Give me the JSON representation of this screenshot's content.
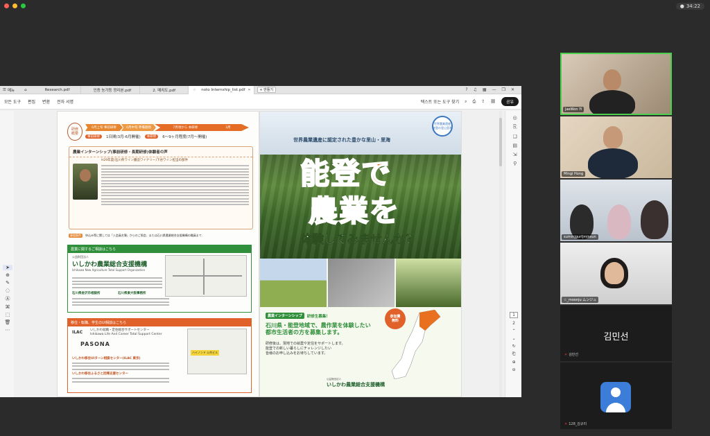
{
  "window": {
    "clock": "34:22"
  },
  "pdf": {
    "tabs": [
      {
        "label": "메뉴"
      },
      {
        "label": "Research.pdf"
      },
      {
        "label": "인증 농가등 정리본.pdf"
      },
      {
        "label": "2. 매치도.pdf"
      },
      {
        "label": "noto Internship_list.pdf",
        "active": true
      }
    ],
    "new_tab_label": "+ 만들기",
    "menu": [
      "모든 도구",
      "편집",
      "변환",
      "전자 서명"
    ],
    "search_placeholder": "텍스트 또는 도구 찾기",
    "share_label": "공유",
    "page_numbers": [
      "1",
      "2"
    ]
  },
  "doc_left": {
    "schedule_badge": "研修\n概要",
    "steps": [
      "6月上旬  事前研修",
      "6月中旬  準備期間",
      "7月頃から   本研修"
    ],
    "step_end": "3月",
    "line2_tag1": "事前研修",
    "line2_text1": "1日間(3月-6月開催)",
    "line2_tag2": "本研修",
    "line2_text2": "6〜9ヶ月程度(7月〜開催)",
    "interview_title": "農業インターンシップ(事前研修・長期研修)体験者の声",
    "interview_name": "H29年度(石川県ワイン醸造ワイナリー)下谷ワイン担当の部件",
    "note_tag": "参加条件",
    "note_text": "申込み等に関しては「入会員名簿」からのご照会、または石川県農業総合支援機構の職員まで.",
    "box1_title": "農業に関するご相談はこちら",
    "org_name": "いしかわ農業総合支援機構",
    "org_prefix": "公益財団法人",
    "org_en": "Ishikawa New Agriculture Total Support Organization",
    "branch1": "石川県金沢市相談所",
    "branch2": "石川県東大阪事務所",
    "box2_title": "移住・転職、学生のUI相談はこちら",
    "ilac_logo": "ILAC",
    "ilac_text": "いしかわ就職・定住総合サポートセンター\nIshikawa Life And Career Total Support Center",
    "pasona": "PASONA",
    "or_head1": "いしかわ移住UIターン相談センター(ILAC 東京)",
    "or_head2": "いしかわ移住ふるさと回帰支援センター",
    "map2_label": "ハイノンド  公共ビル"
  },
  "doc_right": {
    "emblem_text": "世界農業遺産\n能登の里山里海",
    "subtitle": "世界農業遺産に認定された豊かな里山・里海",
    "big1": "能登で",
    "big2": "農業を",
    "big3": "体験してみませんか？",
    "recruit_tag": "農業インターンシップ",
    "recruit_text": "研修生募集！",
    "free_badge": "参加費\n無料",
    "headline": "石川県・能登地域で、農作業を体験したい\n都市生活者の方を募集します。",
    "body": "研修後は、現地での就農や定住をサポートします。\n能登での新しい暮らしにチャレンジしたい\n皆様のお申し込みをお待ちしています。",
    "footer_prefix": "公益財団法人",
    "footer_org": "いしかわ農業総合支援機構"
  },
  "participants": [
    {
      "name": "JaeWon Yi"
    },
    {
      "name": "Mingi Hong"
    },
    {
      "name": "sumin|gurl|minsun"
    },
    {
      "name": "☆_moonju ムンジュ"
    },
    {
      "name": "김민선",
      "small": "김민선",
      "video": false
    },
    {
      "name": "128_김규리",
      "video": false
    }
  ],
  "colors": {
    "accent_orange": "#e0622a",
    "accent_green": "#2f8f3a",
    "active_speaker": "#4ccf4c"
  }
}
